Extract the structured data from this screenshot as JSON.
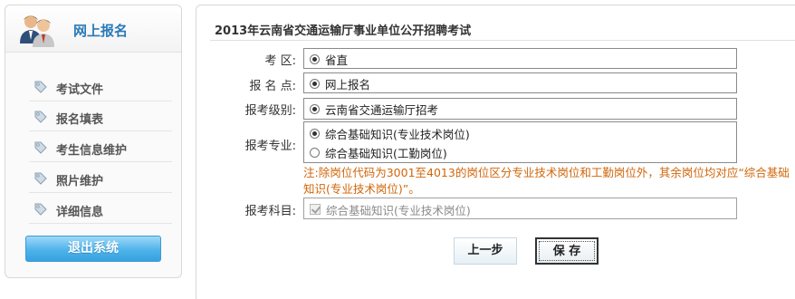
{
  "sidebar": {
    "title": "网上报名",
    "items": [
      {
        "label": "考试文件"
      },
      {
        "label": "报名填表"
      },
      {
        "label": "考生信息维护"
      },
      {
        "label": "照片维护"
      },
      {
        "label": "详细信息"
      }
    ],
    "logout_label": "退出系统"
  },
  "main": {
    "title": "2013年云南省交通运输厅事业单位公开招聘考试",
    "fields": {
      "exam_area": {
        "label": "考  区:",
        "options": [
          {
            "label": "省直",
            "selected": true
          }
        ]
      },
      "exam_site": {
        "label": "报 名 点:",
        "options": [
          {
            "label": "网上报名",
            "selected": true
          }
        ]
      },
      "exam_level": {
        "label": "报考级别:",
        "options": [
          {
            "label": "云南省交通运输厅招考",
            "selected": true
          }
        ]
      },
      "major": {
        "label": "报考专业:",
        "options": [
          {
            "label": "综合基础知识(专业技术岗位)",
            "selected": true
          },
          {
            "label": "综合基础知识(工勤岗位)",
            "selected": false
          }
        ]
      },
      "note": "注:除岗位代码为3001至4013的岗位区分专业技术岗位和工勤岗位外，其余岗位均对应“综合基础知识(专业技术岗位)”。",
      "subject": {
        "label": "报考科目:",
        "options": [
          {
            "label": "综合基础知识(专业技术岗位)",
            "checked": true,
            "disabled": true
          }
        ]
      }
    },
    "buttons": {
      "prev": "上一步",
      "save": "保 存"
    }
  },
  "colors": {
    "accent_blue": "#2a7ab8",
    "note_orange": "#d0660a",
    "logout_button": "#4fb3ea"
  }
}
